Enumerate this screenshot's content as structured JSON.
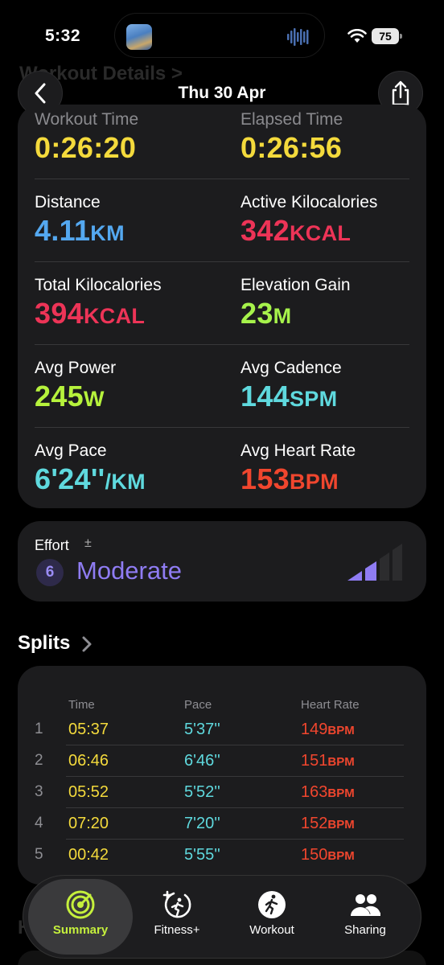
{
  "status": {
    "time": "5:32",
    "battery": "75"
  },
  "nav": {
    "ghost_title": "Workout Details >",
    "title": "Thu 30 Apr"
  },
  "metrics": {
    "workout_time": {
      "label": "Workout Time",
      "value": "0:26:20",
      "unit": ""
    },
    "elapsed_time": {
      "label": "Elapsed Time",
      "value": "0:26:56",
      "unit": ""
    },
    "distance": {
      "label": "Distance",
      "value": "4.11",
      "unit": "KM"
    },
    "active_kcal": {
      "label": "Active Kilocalories",
      "value": "342",
      "unit": "KCAL"
    },
    "total_kcal": {
      "label": "Total Kilocalories",
      "value": "394",
      "unit": "KCAL"
    },
    "elevation": {
      "label": "Elevation Gain",
      "value": "23",
      "unit": "M"
    },
    "avg_power": {
      "label": "Avg Power",
      "value": "245",
      "unit": "W"
    },
    "avg_cadence": {
      "label": "Avg Cadence",
      "value": "144",
      "unit": "SPM"
    },
    "avg_pace": {
      "label": "Avg Pace",
      "value": "6'24''",
      "unit": "/KM"
    },
    "avg_hr": {
      "label": "Avg Heart Rate",
      "value": "153",
      "unit": "BPM"
    }
  },
  "effort": {
    "label": "Effort",
    "pm": "±",
    "score": "6",
    "word": "Moderate",
    "level_fraction": 0.5
  },
  "splits": {
    "title": "Splits",
    "headers": {
      "time": "Time",
      "pace": "Pace",
      "hr": "Heart Rate"
    },
    "hr_unit": "BPM",
    "rows": [
      {
        "idx": "1",
        "time": "05:37",
        "pace": "5'37''",
        "hr": "149"
      },
      {
        "idx": "2",
        "time": "06:46",
        "pace": "6'46''",
        "hr": "151"
      },
      {
        "idx": "3",
        "time": "05:52",
        "pace": "5'52''",
        "hr": "163"
      },
      {
        "idx": "4",
        "time": "07:20",
        "pace": "7'20''",
        "hr": "152"
      },
      {
        "idx": "5",
        "time": "00:42",
        "pace": "5'55''",
        "hr": "150"
      }
    ]
  },
  "ghost_bottom": "He",
  "tabs": [
    {
      "label": "Summary",
      "icon": "summary-rings-icon",
      "active": true
    },
    {
      "label": "Fitness+",
      "icon": "fitness-plus-icon",
      "active": false
    },
    {
      "label": "Workout",
      "icon": "running-figure-icon",
      "active": false
    },
    {
      "label": "Sharing",
      "icon": "people-icon",
      "active": false
    }
  ],
  "colors": {
    "time": "#f4da3c",
    "distance": "#54a8f0",
    "kcal": "#ed3457",
    "elevation": "#a6f24b",
    "power": "#b6f23c",
    "cadence": "#5fd9de",
    "pace": "#5fd9de",
    "hr": "#f0462e",
    "effort": "#8f7cf3",
    "tab_active": "#c5f03c"
  }
}
